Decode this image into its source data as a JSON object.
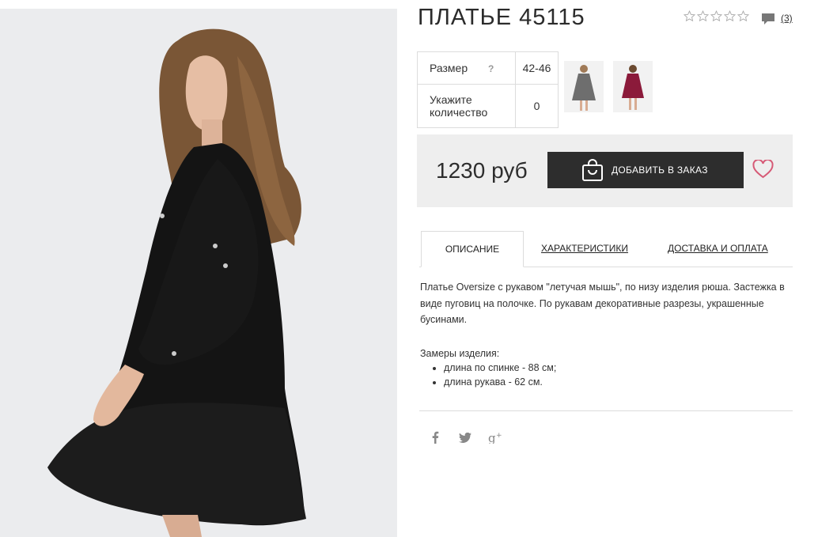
{
  "product": {
    "title": "ПЛАТЬЕ 45115",
    "rating_stars": 5,
    "reviews_count": "(3)"
  },
  "options": {
    "size_label": "Размер",
    "size_help": "?",
    "size_value": "42-46",
    "quantity_label": "Укажите количество",
    "quantity_value": "0"
  },
  "thumbnails": [
    {
      "name": "gray-dress",
      "color": "#6e6e6e"
    },
    {
      "name": "burgundy-dress",
      "color": "#8b1a3a"
    }
  ],
  "purchase": {
    "price": "1230 руб",
    "add_to_order_label": "ДОБАВИТЬ В ЗАКАЗ",
    "wishlist_icon": "heart-icon",
    "heart_color": "#d65a76",
    "button_color": "#2d2d2d"
  },
  "tabs": [
    {
      "label": "ОПИСАНИЕ",
      "active": true
    },
    {
      "label": "ХАРАКТЕРИСТИКИ",
      "active": false
    },
    {
      "label": "ДОСТАВКА И ОПЛАТА",
      "active": false
    }
  ],
  "description": {
    "text": "Платье Oversize с рукавом \"летучая мышь\", по низу изделия рюша. Застежка в виде пуговиц на полочке. По рукавам декоративные разрезы, украшенные бусинами.",
    "measures_title": "Замеры изделия:",
    "measures": [
      "длина по спинке - 88 см;",
      "длина рукава - 62 см."
    ]
  },
  "share": [
    {
      "name": "facebook-icon",
      "glyph": "f"
    },
    {
      "name": "twitter-icon",
      "glyph": "t"
    },
    {
      "name": "google-plus-icon",
      "glyph": "g+"
    }
  ]
}
